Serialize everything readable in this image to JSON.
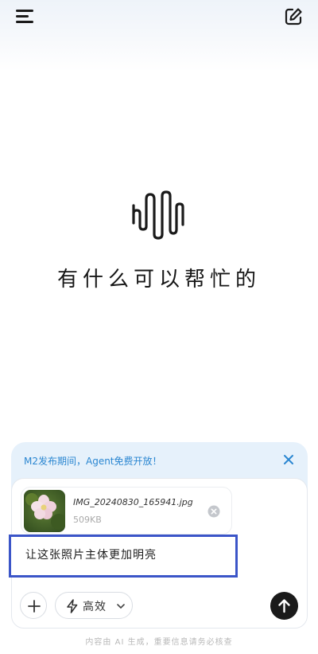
{
  "header": {
    "menu_icon": "hamburger-menu-icon",
    "new_chat_icon": "edit-pencil-square-icon"
  },
  "hero": {
    "logo_icon": "soundwave-logo-icon",
    "greeting": "有什么可以帮忙的"
  },
  "promo": {
    "text": "M2发布期间，Agent免费开放！",
    "close_icon": "close-icon",
    "text_color": "#2a86d1"
  },
  "composer": {
    "attachment": {
      "file_name": "IMG_20240830_165941.jpg",
      "file_size": "509KB",
      "thumbnail_icon": "flower-photo-thumbnail",
      "remove_icon": "remove-circle-icon"
    },
    "prompt_text": "让这张照片主体更加明亮",
    "highlight_color": "#3b55c8",
    "add_icon": "plus-icon",
    "mode": {
      "icon": "lightning-icon",
      "label": "高效",
      "chevron_icon": "chevron-down-icon"
    },
    "send_icon": "arrow-up-icon"
  },
  "footer": {
    "disclaimer": "内容由 AI 生成，重要信息请务必核查"
  }
}
